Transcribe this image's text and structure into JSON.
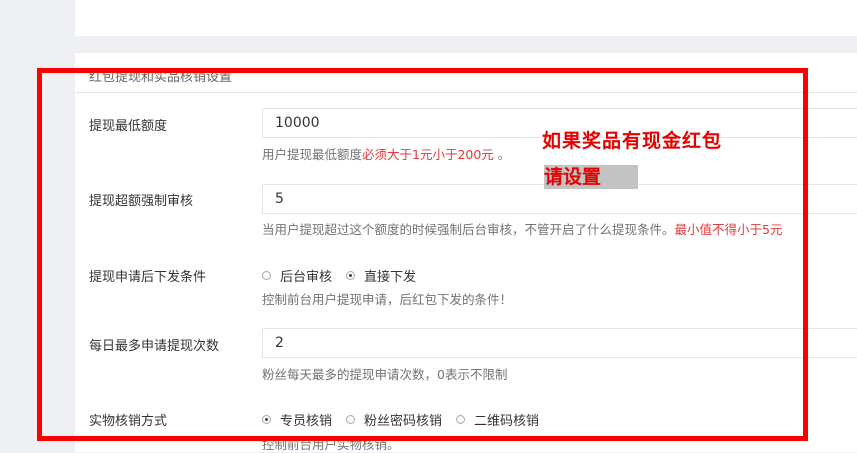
{
  "section": {
    "title": "红包提现和实品核销设置"
  },
  "rows": [
    {
      "label": "提现最低额度",
      "value": "10000",
      "help_prefix": "用户提现最低额度",
      "help_red": "必须大于1元小于200元",
      "help_suffix": " 。"
    },
    {
      "label": "提现超额强制审核",
      "value": "5",
      "help_prefix": "当用户提现超过这个额度的时候强制后台审核，不管开启了什么提现条件。",
      "help_red": "最小值不得小于5元"
    },
    {
      "label": "提现申请后下发条件",
      "options": [
        "后台审核",
        "直接下发"
      ],
      "selected": "直接下发",
      "help": "控制前台用户提现申请，后红包下发的条件！"
    },
    {
      "label": "每日最多申请提现次数",
      "value": "2",
      "help": "粉丝每天最多的提现申请次数，0表示不限制"
    },
    {
      "label": "实物核销方式",
      "options": [
        "专员核销",
        "粉丝密码核销",
        "二维码核销"
      ],
      "selected": "专员核销",
      "help": "控制前台用户实物核销。"
    }
  ],
  "annotation": {
    "line1": "如果奖品有现金红包",
    "line2": "请设置",
    "color": "#ff0000"
  }
}
